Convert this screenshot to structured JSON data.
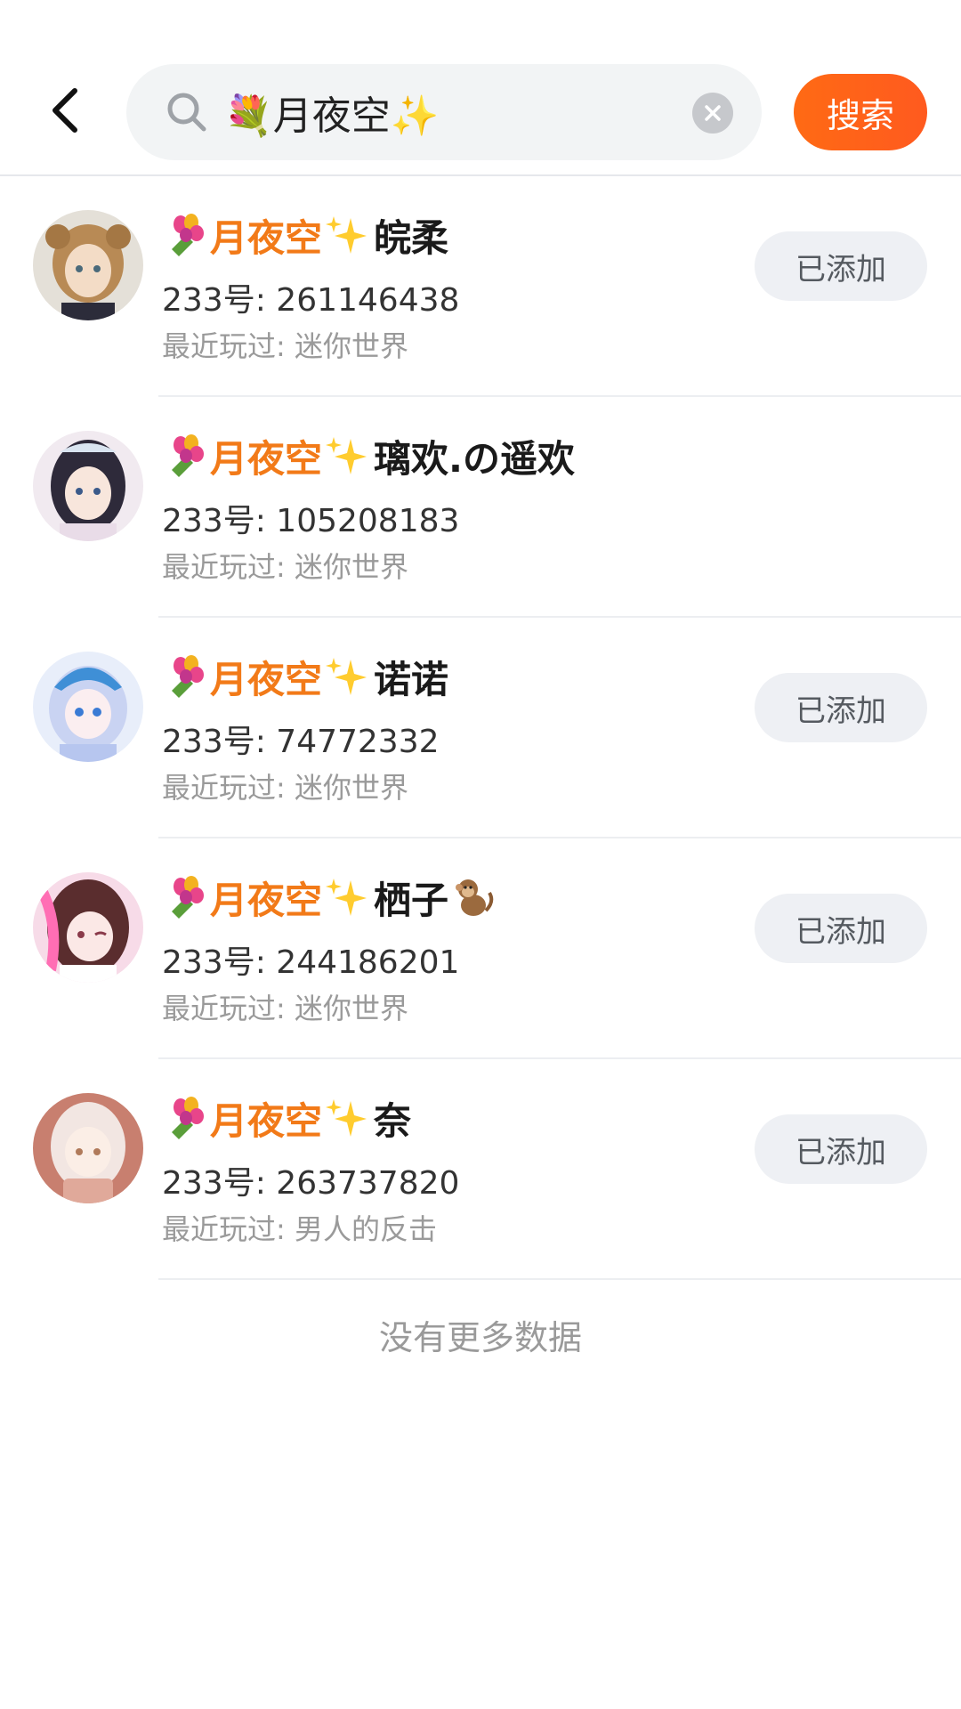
{
  "colors": {
    "accent": "#ff6a14",
    "keyword": "#f27a18",
    "added_bg": "#eef0f4",
    "search_bg": "#f2f4f5"
  },
  "header": {
    "back_icon": "chevron-left-icon",
    "search_icon": "search-icon",
    "clear_icon": "clear-icon",
    "search_value": "💐月夜空✨",
    "search_button_label": "搜索"
  },
  "results": [
    {
      "prefix_emoji": "bouquet",
      "keyword": "月夜空",
      "suffix_emoji": "sparkles",
      "name_rest": "皖柔",
      "trailing_emoji": "",
      "uid": "233号: 261146438",
      "played": "最近玩过: 迷你世界",
      "button_label": "已添加"
    },
    {
      "prefix_emoji": "bouquet",
      "keyword": "月夜空",
      "suffix_emoji": "sparkles",
      "name_rest": "璃欢.の遥欢",
      "trailing_emoji": "",
      "uid": "233号: 105208183",
      "played": "最近玩过: 迷你世界",
      "button_label": ""
    },
    {
      "prefix_emoji": "bouquet",
      "keyword": "月夜空",
      "suffix_emoji": "sparkles",
      "name_rest": "诺诺",
      "trailing_emoji": "",
      "uid": "233号: 74772332",
      "played": "最近玩过: 迷你世界",
      "button_label": "已添加"
    },
    {
      "prefix_emoji": "bouquet",
      "keyword": "月夜空",
      "suffix_emoji": "sparkles",
      "name_rest": "栖子",
      "trailing_emoji": "monkey",
      "uid": "233号: 244186201",
      "played": "最近玩过: 迷你世界",
      "button_label": "已添加"
    },
    {
      "prefix_emoji": "bouquet",
      "keyword": "月夜空",
      "suffix_emoji": "sparkles",
      "name_rest": "奈",
      "trailing_emoji": "",
      "uid": "233号: 263737820",
      "played": "最近玩过: 男人的反击",
      "button_label": "已添加"
    }
  ],
  "footer": {
    "no_more": "没有更多数据"
  }
}
